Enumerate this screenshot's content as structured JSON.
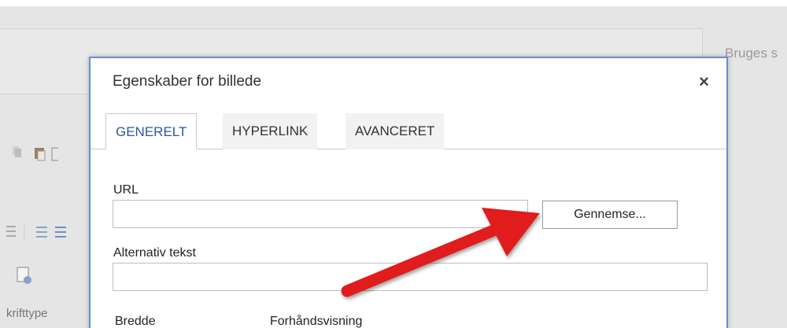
{
  "background": {
    "right_text": "Bruges s",
    "font_label": "krifttype"
  },
  "dialog": {
    "title": "Egenskaber for billede",
    "close_symbol": "×",
    "tabs": [
      {
        "label": "GENERELT",
        "active": true
      },
      {
        "label": "HYPERLINK",
        "active": false
      },
      {
        "label": "AVANCERET",
        "active": false
      }
    ],
    "url_label": "URL",
    "url_value": "",
    "browse_label": "Gennemse...",
    "alt_label": "Alternativ tekst",
    "alt_value": "",
    "width_label": "Bredde",
    "preview_label": "Forhåndsvisning"
  },
  "annotation": {
    "arrow_color": "#e01f1f"
  }
}
